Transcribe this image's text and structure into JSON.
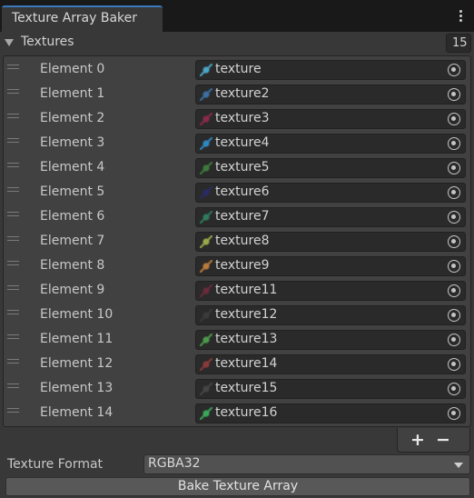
{
  "window": {
    "tab_title": "Texture Array Baker"
  },
  "textures": {
    "label": "Textures",
    "count": "15",
    "elements": [
      {
        "label": "Element 0",
        "value": "texture",
        "thumb_color": "#4aa6c8"
      },
      {
        "label": "Element 1",
        "value": "texture2",
        "thumb_color": "#3a6fa0"
      },
      {
        "label": "Element 2",
        "value": "texture3",
        "thumb_color": "#8a2a4a"
      },
      {
        "label": "Element 3",
        "value": "texture4",
        "thumb_color": "#2f88c0"
      },
      {
        "label": "Element 4",
        "value": "texture5",
        "thumb_color": "#3c7a3c"
      },
      {
        "label": "Element 5",
        "value": "texture6",
        "thumb_color": "#2a2a6a"
      },
      {
        "label": "Element 6",
        "value": "texture7",
        "thumb_color": "#2f7a5a"
      },
      {
        "label": "Element 7",
        "value": "texture8",
        "thumb_color": "#9aa84a"
      },
      {
        "label": "Element 8",
        "value": "texture9",
        "thumb_color": "#b87a3a"
      },
      {
        "label": "Element 9",
        "value": "texture11",
        "thumb_color": "#6a2a3a"
      },
      {
        "label": "Element 10",
        "value": "texture12",
        "thumb_color": "#3a3a3a"
      },
      {
        "label": "Element 11",
        "value": "texture13",
        "thumb_color": "#4a9a4a"
      },
      {
        "label": "Element 12",
        "value": "texture14",
        "thumb_color": "#8a3a3a"
      },
      {
        "label": "Element 13",
        "value": "texture15",
        "thumb_color": "#444444"
      },
      {
        "label": "Element 14",
        "value": "texture16",
        "thumb_color": "#3aa85a"
      }
    ],
    "add_label": "+",
    "remove_label": "−"
  },
  "format": {
    "label": "Texture Format",
    "value": "RGBA32"
  },
  "bake": {
    "label": "Bake Texture Array"
  }
}
